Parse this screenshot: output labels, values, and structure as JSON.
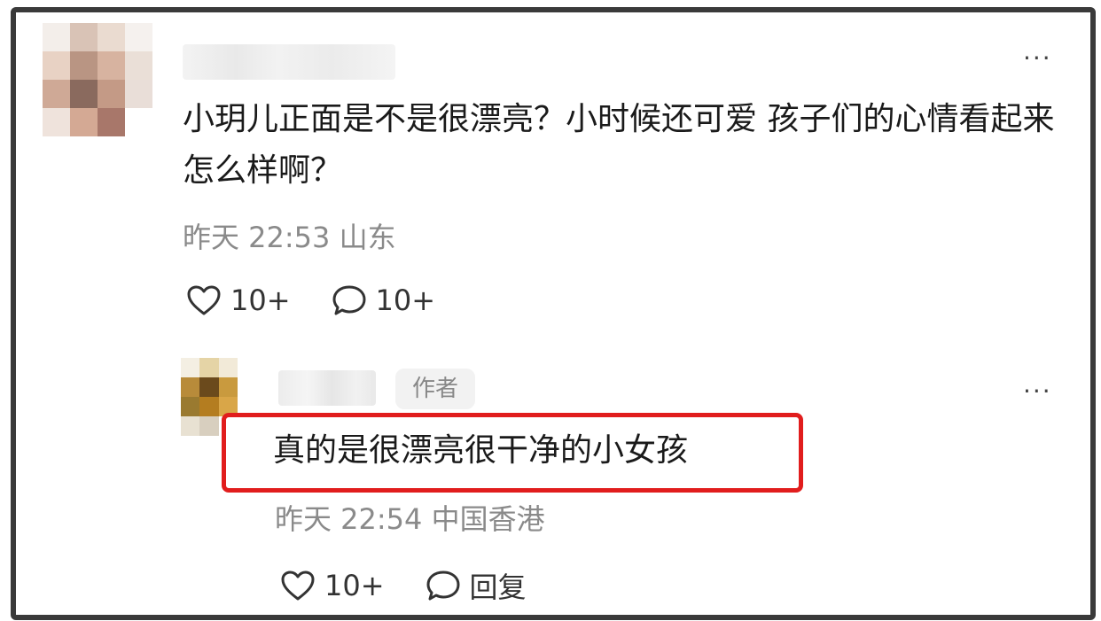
{
  "comment": {
    "text": "小玥儿正面是不是很漂亮？小时候还可爱 孩子们的心情看起来怎么样啊？",
    "meta": "昨天 22:53 山东",
    "like_count": "10+",
    "reply_count": "10+"
  },
  "reply": {
    "author_badge": "作者",
    "text": "真的是很漂亮很干净的小女孩",
    "meta": "昨天 22:54 中国香港",
    "like_count": "10+",
    "reply_label": "回复"
  },
  "colors": {
    "highlight_border": "#e11d1d",
    "meta_text": "#8a8a8a"
  },
  "icons": {
    "like": "heart-icon",
    "reply": "speech-bubble-icon",
    "more": "more-dots-icon"
  }
}
